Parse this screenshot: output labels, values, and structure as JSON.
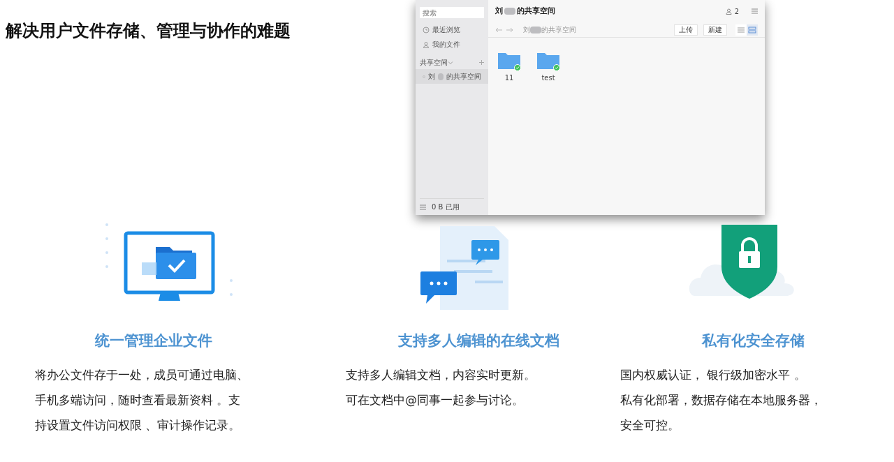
{
  "headline": "解决用户文件存储、管理与协作的难题",
  "app_window": {
    "sidebar": {
      "search": {
        "placeholder": "搜索"
      },
      "items": [
        {
          "kind": "recent",
          "label": "最近浏览",
          "selected": false
        },
        {
          "kind": "mine",
          "label": "我的文件",
          "selected": false
        }
      ],
      "section": {
        "label": "共享空间",
        "expanded": true
      },
      "spaces": [
        {
          "label_start": "刘",
          "label_end": "的共享空间",
          "selected": true
        }
      ],
      "usage": "0 B 已用"
    },
    "title_start": "刘",
    "title_end": "的共享空间",
    "member_count": "2",
    "breadcrumb_start": "刘",
    "breadcrumb_end": "的共享空间",
    "buttons": [
      "上传",
      "新建"
    ],
    "views": [
      {
        "kind": "list",
        "selected": false
      },
      {
        "kind": "grid",
        "selected": true
      }
    ],
    "folders": [
      {
        "name": "11",
        "synced": true
      },
      {
        "name": "test",
        "synced": true
      }
    ]
  },
  "features": [
    {
      "kind": "monitor",
      "title": "统一管理企业文件",
      "lines": [
        "将办公文件存于一处，成员可通过电脑、",
        "手机多端访问，随时查看最新资料 。支",
        "持设置文件访问权限 、审计操作记录。"
      ]
    },
    {
      "kind": "chat",
      "title": "支持多人编辑的在线文档",
      "lines": [
        "支持多人编辑文档，内容实时更新。",
        "可在文档中@同事一起参与讨论。"
      ]
    },
    {
      "kind": "shield",
      "title": "私有化安全存储",
      "lines": [
        "国内权威认证， 银行级加密水平 。",
        "私有化部署，数据存储在本地服务器，",
        "安全可控。"
      ]
    }
  ]
}
